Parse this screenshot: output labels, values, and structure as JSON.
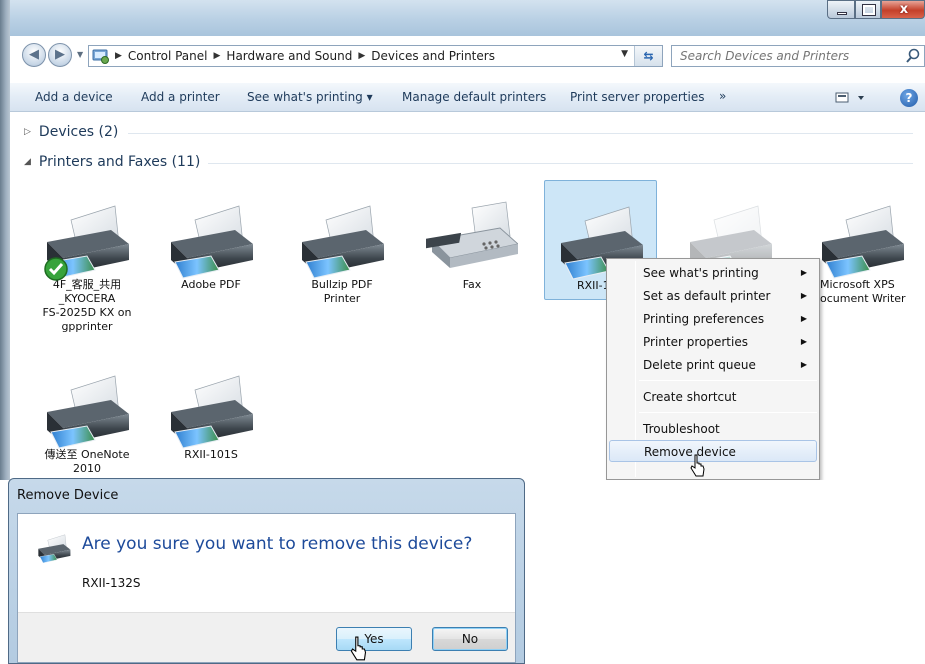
{
  "window": {
    "breadcrumb": [
      "Control Panel",
      "Hardware and Sound",
      "Devices and Printers"
    ],
    "search_placeholder": "Search Devices and Printers",
    "caption": {
      "minimize": "–",
      "maximize": "□",
      "close": "x"
    }
  },
  "commands": {
    "add_device": "Add a device",
    "add_printer": "Add a printer",
    "see_printing": "See what's printing ▾",
    "manage_default": "Manage default printers",
    "print_server": "Print server properties",
    "more": "»"
  },
  "groups": {
    "devices": "Devices (2)",
    "printers": "Printers and Faxes (11)"
  },
  "printers": [
    {
      "label": "4F_客服_共用\n_KYOCERA\nFS-2025D KX on\ngpprinter",
      "icon": "printer-icon",
      "default": true
    },
    {
      "label": "Adobe PDF",
      "icon": "printer-icon"
    },
    {
      "label": "Bullzip PDF\nPrinter",
      "icon": "printer-icon"
    },
    {
      "label": "Fax",
      "icon": "fax-icon"
    },
    {
      "label": "RXII-1",
      "icon": "printer-icon",
      "selected": true
    },
    {
      "label": "",
      "icon": "printer-icon"
    },
    {
      "label": "Microsoft XPS\nocument Writer",
      "icon": "printer-icon"
    },
    {
      "label": "傳送至 OneNote\n2010",
      "icon": "printer-icon"
    },
    {
      "label": "RXII-101S",
      "icon": "printer-icon"
    }
  ],
  "context_menu": {
    "see_printing": "See what's printing",
    "set_default": "Set as default printer",
    "preferences": "Printing preferences",
    "properties": "Printer properties",
    "delete_queue": "Delete print queue",
    "create_shortcut": "Create shortcut",
    "troubleshoot": "Troubleshoot",
    "remove_device": "Remove device"
  },
  "dialog": {
    "title": "Remove Device",
    "question": "Are you sure you want to remove this device?",
    "device_name": "RXII-132S",
    "yes": "Yes",
    "no": "No"
  },
  "colors": {
    "link_blue": "#1d4a9a",
    "selection": "#cde6f7",
    "titlebar": "#b9d0e4"
  }
}
